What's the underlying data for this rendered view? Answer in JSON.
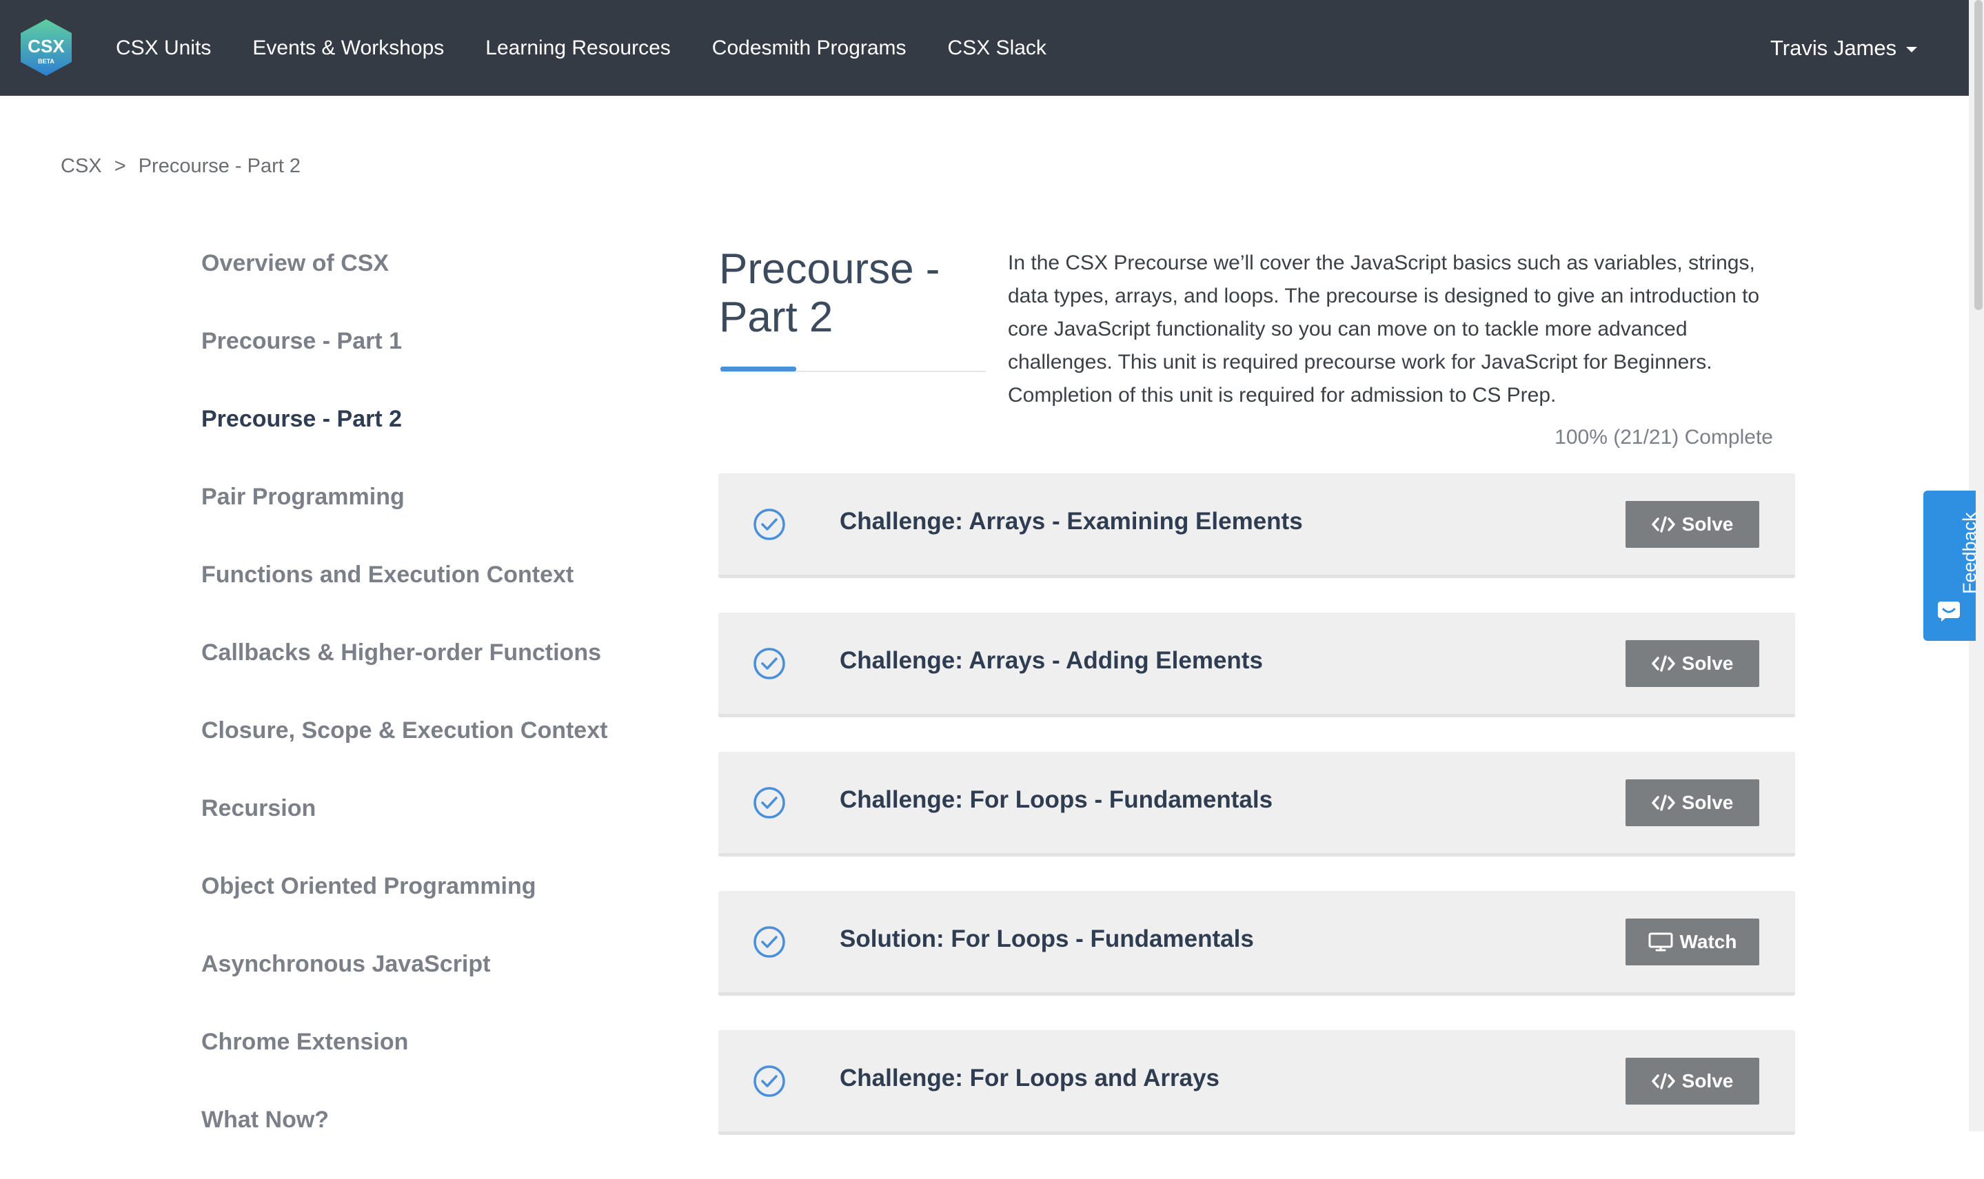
{
  "navbar": {
    "logo_text": "CSX",
    "logo_sub": "BETA",
    "links": [
      "CSX Units",
      "Events & Workshops",
      "Learning Resources",
      "Codesmith Programs",
      "CSX Slack"
    ],
    "user_name": "Travis James"
  },
  "breadcrumb": {
    "root": "CSX",
    "separator": ">",
    "current": "Precourse - Part 2"
  },
  "sidebar": {
    "items": [
      {
        "label": "Overview of CSX"
      },
      {
        "label": "Precourse - Part 1"
      },
      {
        "label": "Precourse - Part 2"
      },
      {
        "label": "Pair Programming"
      },
      {
        "label": "Functions and Execution Context"
      },
      {
        "label": "Callbacks & Higher-order Functions"
      },
      {
        "label": "Closure, Scope & Execution Context"
      },
      {
        "label": "Recursion"
      },
      {
        "label": "Object Oriented Programming"
      },
      {
        "label": "Asynchronous JavaScript"
      },
      {
        "label": "Chrome Extension"
      },
      {
        "label": "What Now?"
      }
    ],
    "active_index": 2
  },
  "unit": {
    "title_line1": "Precourse -",
    "title_line2": "Part 2",
    "description": "In the CSX Precourse we’ll cover the JavaScript basics such as variables, strings, data types, arrays, and loops. The precourse is designed to give an introduction to core JavaScript functionality so you can move on to tackle more advanced challenges. This unit is required precourse work for JavaScript for Beginners. Completion of this unit is required for admission to CS Prep.",
    "progress_text": "100% (21/21) Complete",
    "progress_fraction": 1.0
  },
  "challenges": [
    {
      "title": "Challenge: Arrays - Examining Elements",
      "action": "Solve",
      "action_icon": "code-icon",
      "completed": true
    },
    {
      "title": "Challenge: Arrays - Adding Elements",
      "action": "Solve",
      "action_icon": "code-icon",
      "completed": true
    },
    {
      "title": "Challenge: For Loops - Fundamentals",
      "action": "Solve",
      "action_icon": "code-icon",
      "completed": true
    },
    {
      "title": "Solution: For Loops - Fundamentals",
      "action": "Watch",
      "action_icon": "monitor-icon",
      "completed": true
    },
    {
      "title": "Challenge: For Loops and Arrays",
      "action": "Solve",
      "action_icon": "code-icon",
      "completed": true
    }
  ],
  "feedback": {
    "label": "Feedback"
  },
  "colors": {
    "navbar": "#343b44",
    "accent": "#4a90d9",
    "button": "#7b7e81",
    "feedback": "#2f8fe0",
    "logo_top": "#5fcf9f",
    "logo_bottom": "#2f7fd0"
  }
}
